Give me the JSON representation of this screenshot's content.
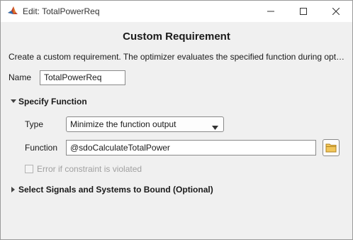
{
  "window": {
    "title": "Edit: TotalPowerReq"
  },
  "heading": "Custom Requirement",
  "description": "Create a custom requirement. The optimizer evaluates the specified function during opt…",
  "name_field": {
    "label": "Name",
    "value": "TotalPowerReq"
  },
  "specify_function": {
    "header": "Specify Function",
    "expanded": true,
    "type": {
      "label": "Type",
      "selected": "Minimize the function output"
    },
    "function": {
      "label": "Function",
      "value": "@sdoCalculateTotalPower"
    },
    "error_checkbox": {
      "label": "Error if constraint is violated",
      "checked": false,
      "enabled": false
    }
  },
  "select_signals": {
    "header": "Select Signals and Systems to Bound (Optional)",
    "expanded": false
  },
  "icons": {
    "app": "matlab-icon",
    "minimize": "minimize-icon",
    "maximize": "maximize-icon",
    "close": "close-icon",
    "browse": "folder-icon"
  },
  "colors": {
    "window_bg": "#f0f0f0",
    "titlebar_bg": "#ffffff",
    "folder": "#e8b43c"
  }
}
